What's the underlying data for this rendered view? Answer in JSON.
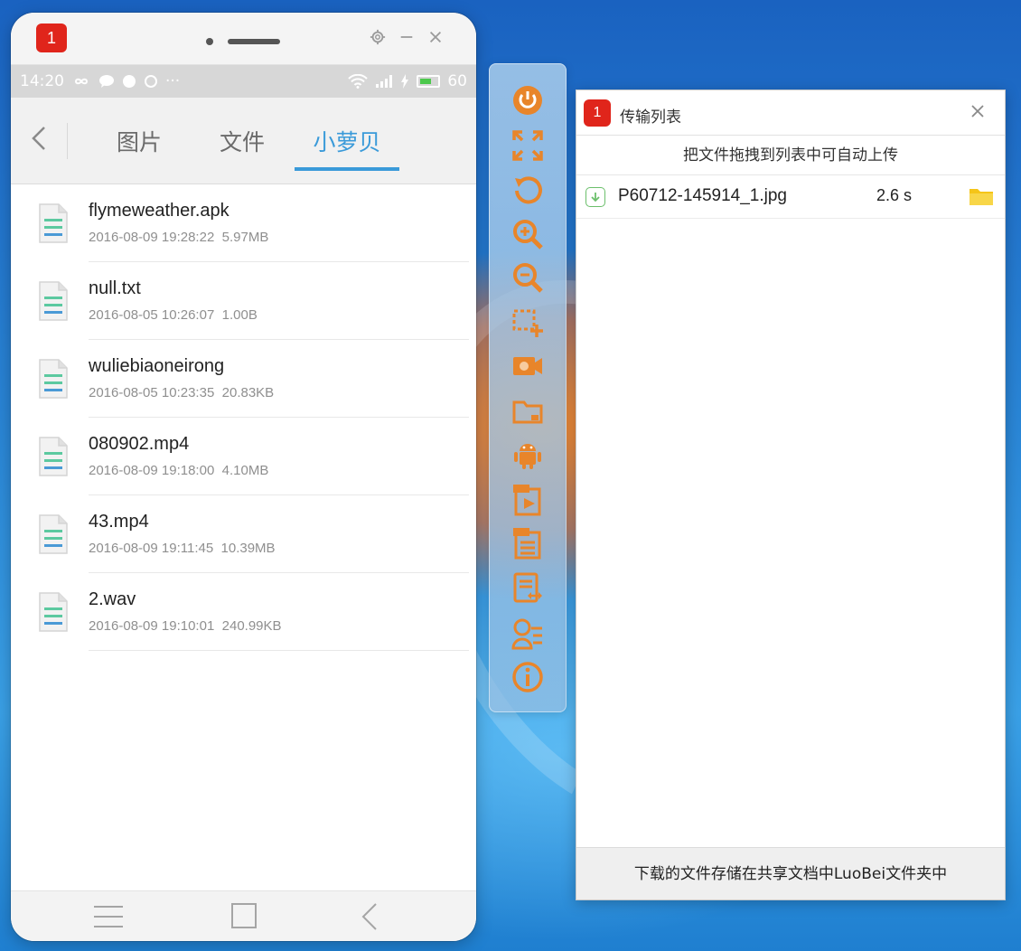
{
  "phone": {
    "badge": "1",
    "status": {
      "time": "14:20",
      "battery": "60"
    },
    "tabs": [
      {
        "label": "图片"
      },
      {
        "label": "文件"
      },
      {
        "label": "小萝贝",
        "active": true
      }
    ],
    "files": [
      {
        "name": "flymeweather.apk",
        "date": "2016-08-09 19:28:22",
        "size": "5.97MB"
      },
      {
        "name": "null.txt",
        "date": "2016-08-05 10:26:07",
        "size": "1.00B"
      },
      {
        "name": "wuliebiaoneirong",
        "date": "2016-08-05 10:23:35",
        "size": "20.83KB"
      },
      {
        "name": "080902.mp4",
        "date": "2016-08-09 19:18:00",
        "size": "4.10MB"
      },
      {
        "name": "43.mp4",
        "date": "2016-08-09 19:11:45",
        "size": "10.39MB"
      },
      {
        "name": "2.wav",
        "date": "2016-08-09 19:10:01",
        "size": "240.99KB"
      }
    ]
  },
  "toolbar": {
    "icons": [
      "power-icon",
      "fullscreen-icon",
      "rotate-icon",
      "zoom-in-icon",
      "zoom-out-icon",
      "screenshot-icon",
      "record-video-icon",
      "folder-icon",
      "android-icon",
      "cmd-video-icon",
      "cmd-document-icon",
      "transfer-list-icon",
      "user-list-icon",
      "info-icon"
    ],
    "accent": "#e8852a"
  },
  "dialog": {
    "badge": "1",
    "title": "传输列表",
    "hint": "把文件拖拽到列表中可自动上传",
    "transfers": [
      {
        "name": "P60712-145914_1.jpg",
        "time": "2.6 s"
      }
    ],
    "footer": "下载的文件存储在共享文档中LuoBei文件夹中"
  },
  "colors": {
    "tab_active": "#3a9ad9",
    "badge": "#e0251b",
    "file_icon_green": "#5cc9a0",
    "file_icon_blue": "#4a9ad6",
    "folder": "#f5c518"
  }
}
